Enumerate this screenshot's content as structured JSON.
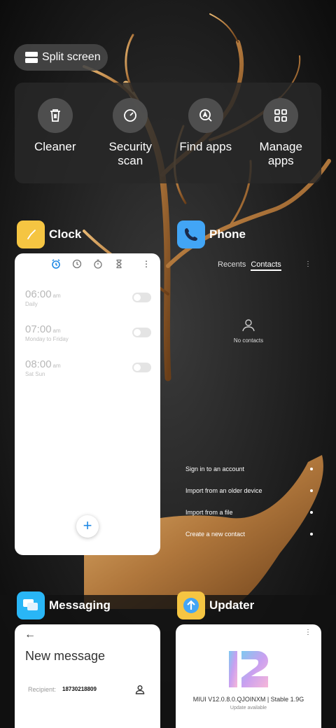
{
  "split_screen": {
    "label": "Split screen"
  },
  "tools": [
    {
      "label": "Cleaner",
      "icon": "trash-icon"
    },
    {
      "label": "Security\nscan",
      "icon": "security-scan-icon"
    },
    {
      "label": "Find apps",
      "icon": "find-apps-icon"
    },
    {
      "label": "Manage\napps",
      "icon": "grid-icon"
    }
  ],
  "apps": {
    "clock": {
      "name": "Clock",
      "icon_color": "#f5c542",
      "alarms": [
        {
          "time": "06:00",
          "ampm": "am",
          "days": "Daily"
        },
        {
          "time": "07:00",
          "ampm": "am",
          "days": "Monday to Friday"
        },
        {
          "time": "08:00",
          "ampm": "am",
          "days": "Sat Sun"
        }
      ],
      "fab": "+",
      "menu": "⋮"
    },
    "phone": {
      "name": "Phone",
      "icon_color": "#42a5f5",
      "tabs": {
        "recents": "Recents",
        "contacts": "Contacts"
      },
      "menu": "⋮",
      "empty": "No contacts",
      "actions": [
        "Sign in to an account",
        "Import from an older device",
        "Import from a file",
        "Create a new contact"
      ]
    },
    "messaging": {
      "name": "Messaging",
      "icon_color": "#29b6f6",
      "back": "←",
      "title": "New message",
      "recipient_label": "Recipient:",
      "recipient_number": "18730218809"
    },
    "updater": {
      "name": "Updater",
      "icon_color": "#f5c542",
      "menu": "⋮",
      "version": "MIUI V12.0.8.0.QJOINXM | Stable 1.9G",
      "status": "Update available"
    }
  }
}
